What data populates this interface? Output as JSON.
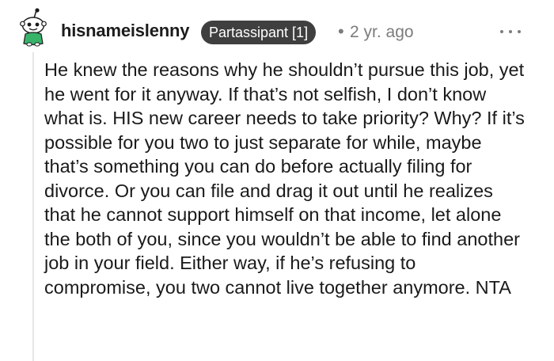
{
  "comment": {
    "author": "hisnameislenny",
    "flair": "Partassipant [1]",
    "separator": "•",
    "timestamp": "2 yr. ago",
    "more_icon": "more-horizontal-icon",
    "avatar_icon": "snoo-avatar-icon",
    "body": "He knew the reasons why he shouldn’t pursue this job, yet he went for it anyway. If that’s not selfish, I don’t know what is. HIS new career needs to take priority? Why? If it’s possible for you two to just separate for while, maybe that’s something you can do before actually filing for divorce. Or you can file and drag it out until he realizes that he cannot support himself on that income, let alone the both of you, since you wouldn’t be able to find another job in your field. Either way, if he’s refusing to compromise, you two cannot live together anymore. NTA"
  },
  "colors": {
    "flair_background": "#3f3f3f",
    "flair_text": "#ffffff",
    "meta_text": "#7c7c7c",
    "thread_line": "#e6e6e6",
    "avatar_green": "#38b36a"
  }
}
